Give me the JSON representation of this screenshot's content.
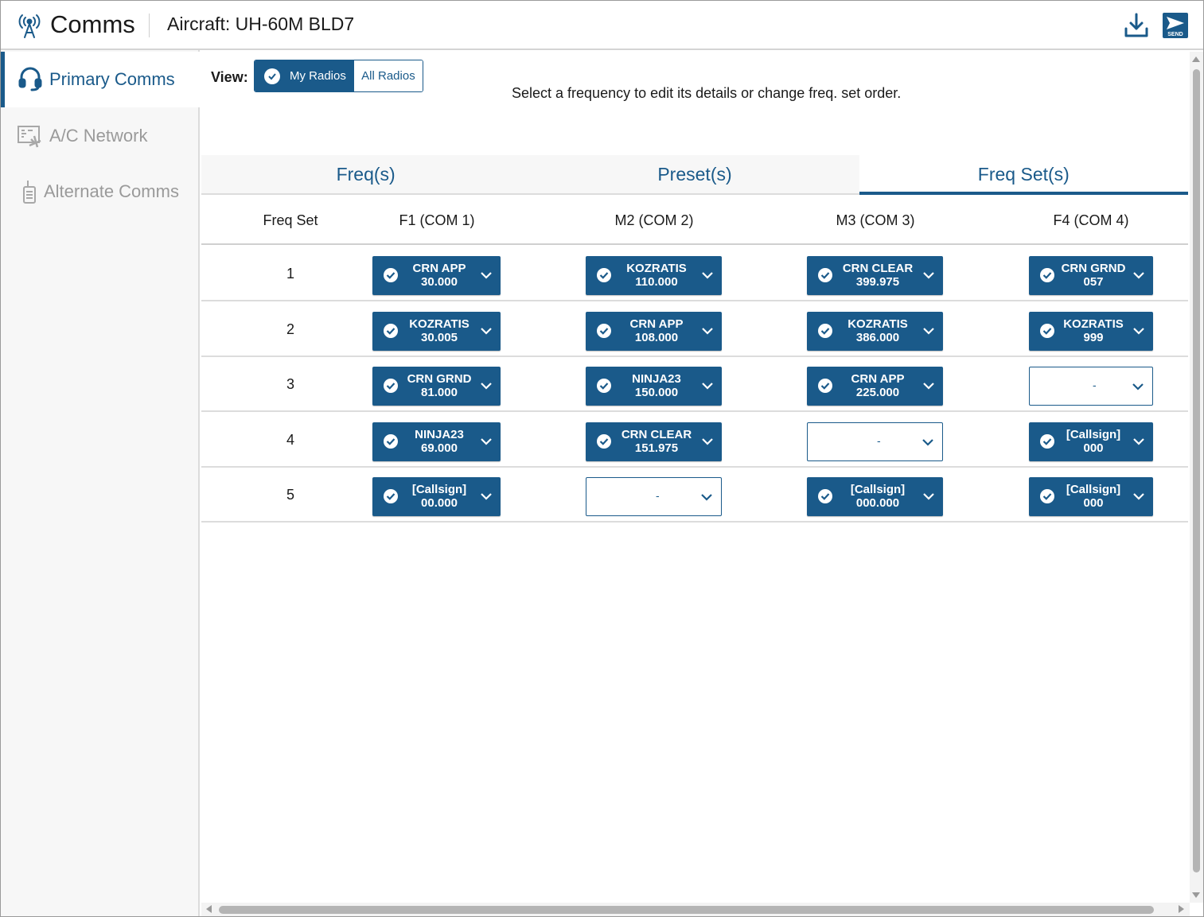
{
  "header": {
    "app_title": "Comms",
    "aircraft_label": "Aircraft: UH-60M BLD7",
    "send_label": "SEND"
  },
  "sidebar": {
    "items": [
      {
        "label": "Primary Comms",
        "icon": "headset-icon",
        "active": true
      },
      {
        "label": "A/C Network",
        "icon": "network-icon",
        "active": false
      },
      {
        "label": "Alternate Comms",
        "icon": "handheld-radio-icon",
        "active": false
      }
    ]
  },
  "view": {
    "label": "View:",
    "options": [
      "My Radios",
      "All Radios"
    ],
    "selected": "My Radios"
  },
  "hint": "Select a frequency to edit its details or change freq. set order.",
  "tabs": [
    {
      "label": "Freq(s)",
      "active": false
    },
    {
      "label": "Preset(s)",
      "active": false
    },
    {
      "label": "Freq Set(s)",
      "active": true
    }
  ],
  "table": {
    "headers": [
      "Freq Set",
      "F1 (COM 1)",
      "M2 (COM 2)",
      "M3 (COM 3)",
      "F4 (COM 4)"
    ],
    "rows": [
      {
        "set": "1",
        "cells": [
          {
            "name": "CRN APP",
            "freq": "30.000"
          },
          {
            "name": "KOZRATIS",
            "freq": "110.000"
          },
          {
            "name": "CRN CLEAR",
            "freq": "399.975"
          },
          {
            "name": "CRN GRND",
            "freq": "057"
          }
        ]
      },
      {
        "set": "2",
        "cells": [
          {
            "name": "KOZRATIS",
            "freq": "30.005"
          },
          {
            "name": "CRN APP",
            "freq": "108.000"
          },
          {
            "name": "KOZRATIS",
            "freq": "386.000"
          },
          {
            "name": "KOZRATIS",
            "freq": "999"
          }
        ]
      },
      {
        "set": "3",
        "cells": [
          {
            "name": "CRN GRND",
            "freq": "81.000"
          },
          {
            "name": "NINJA23",
            "freq": "150.000"
          },
          {
            "name": "CRN APP",
            "freq": "225.000"
          },
          {
            "empty": "-"
          }
        ]
      },
      {
        "set": "4",
        "cells": [
          {
            "name": "NINJA23",
            "freq": "69.000"
          },
          {
            "name": "CRN CLEAR",
            "freq": "151.975"
          },
          {
            "empty": "-"
          },
          {
            "name": "[Callsign]",
            "freq": "000"
          }
        ]
      },
      {
        "set": "5",
        "cells": [
          {
            "name": "[Callsign]",
            "freq": "00.000"
          },
          {
            "empty": "-"
          },
          {
            "name": "[Callsign]",
            "freq": "000.000"
          },
          {
            "name": "[Callsign]",
            "freq": "000"
          }
        ]
      }
    ]
  },
  "colors": {
    "accent": "#1a5a8a",
    "inactive_text": "#9a9a9a",
    "sidebar_bg": "#f7f7f7"
  }
}
